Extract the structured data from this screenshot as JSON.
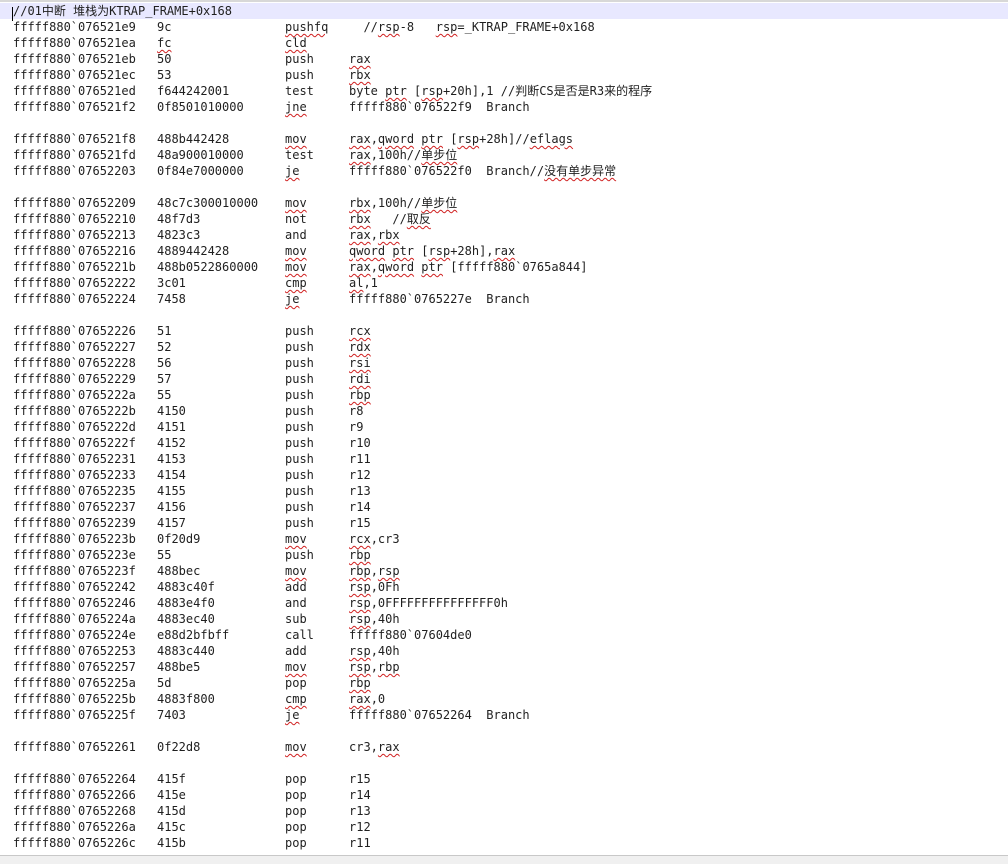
{
  "editor": {
    "colors": {
      "current_line": "#e8e8ff",
      "spell_error": "#d02020"
    },
    "lines": [
      {
        "text": "//01中断 堆栈为KTRAP_FRAME+0x168"
      },
      {
        "addr": "fffff880`076521e9",
        "bytes": "9c",
        "mn": "pushfq",
        "op": "  //rsp-8   rsp=_KTRAP_FRAME+0x168",
        "sq": [
          "pushfq",
          "rsp",
          "rsp"
        ]
      },
      {
        "addr": "fffff880`076521ea",
        "bytes": "fc",
        "mn": "cld",
        "op": "",
        "sq": [
          "fc",
          "cld"
        ]
      },
      {
        "addr": "fffff880`076521eb",
        "bytes": "50",
        "mn": "push",
        "op": "rax",
        "sq": [
          "rax"
        ]
      },
      {
        "addr": "fffff880`076521ec",
        "bytes": "53",
        "mn": "push",
        "op": "rbx",
        "sq": [
          "rbx"
        ]
      },
      {
        "addr": "fffff880`076521ed",
        "bytes": "f644242001",
        "mn": "test",
        "op": "byte ptr [rsp+20h],1 //判断CS是否是R3来的程序",
        "sq": [
          "ptr",
          "rsp"
        ]
      },
      {
        "addr": "fffff880`076521f2",
        "bytes": "0f8501010000",
        "mn": "jne",
        "op": "fffff880`076522f9  Branch",
        "sq": [
          "jne"
        ]
      },
      {
        "blank": true
      },
      {
        "addr": "fffff880`076521f8",
        "bytes": "488b442428",
        "mn": "mov",
        "op": "rax,qword ptr [rsp+28h]//eflags",
        "sq": [
          "mov",
          "rax",
          "qword",
          "ptr",
          "rsp",
          "eflags"
        ]
      },
      {
        "addr": "fffff880`076521fd",
        "bytes": "48a900010000",
        "mn": "test",
        "op": "rax,100h//单步位",
        "sq": [
          "rax",
          "单步位"
        ]
      },
      {
        "addr": "fffff880`07652203",
        "bytes": "0f84e7000000",
        "mn": "je",
        "op": "fffff880`076522f0  Branch//没有单步异常",
        "sq": [
          "je",
          "没有单步异常"
        ]
      },
      {
        "blank": true
      },
      {
        "addr": "fffff880`07652209",
        "bytes": "48c7c300010000",
        "mn": "mov",
        "op": "rbx,100h//单步位",
        "sq": [
          "mov",
          "rbx",
          "单步位"
        ]
      },
      {
        "addr": "fffff880`07652210",
        "bytes": "48f7d3",
        "mn": "not",
        "op": "rbx   //取反",
        "sq": [
          "rbx",
          "取反"
        ]
      },
      {
        "addr": "fffff880`07652213",
        "bytes": "4823c3",
        "mn": "and",
        "op": "rax,rbx",
        "sq": [
          "rax",
          "rbx"
        ]
      },
      {
        "addr": "fffff880`07652216",
        "bytes": "4889442428",
        "mn": "mov",
        "op": "qword ptr [rsp+28h],rax",
        "sq": [
          "mov",
          "qword",
          "ptr",
          "rsp",
          "rax"
        ]
      },
      {
        "addr": "fffff880`0765221b",
        "bytes": "488b0522860000",
        "mn": "mov",
        "op": "rax,qword ptr [fffff880`0765a844]",
        "sq": [
          "mov",
          "rax",
          "qword",
          "ptr"
        ]
      },
      {
        "addr": "fffff880`07652222",
        "bytes": "3c01",
        "mn": "cmp",
        "op": "al,1",
        "sq": [
          "cmp",
          "al"
        ]
      },
      {
        "addr": "fffff880`07652224",
        "bytes": "7458",
        "mn": "je",
        "op": "fffff880`0765227e  Branch",
        "sq": [
          "je"
        ]
      },
      {
        "blank": true
      },
      {
        "addr": "fffff880`07652226",
        "bytes": "51",
        "mn": "push",
        "op": "rcx",
        "sq": [
          "rcx"
        ]
      },
      {
        "addr": "fffff880`07652227",
        "bytes": "52",
        "mn": "push",
        "op": "rdx",
        "sq": [
          "rdx"
        ]
      },
      {
        "addr": "fffff880`07652228",
        "bytes": "56",
        "mn": "push",
        "op": "rsi",
        "sq": [
          "rsi"
        ]
      },
      {
        "addr": "fffff880`07652229",
        "bytes": "57",
        "mn": "push",
        "op": "rdi",
        "sq": [
          "rdi"
        ]
      },
      {
        "addr": "fffff880`0765222a",
        "bytes": "55",
        "mn": "push",
        "op": "rbp",
        "sq": [
          "rbp"
        ]
      },
      {
        "addr": "fffff880`0765222b",
        "bytes": "4150",
        "mn": "push",
        "op": "r8",
        "sq": []
      },
      {
        "addr": "fffff880`0765222d",
        "bytes": "4151",
        "mn": "push",
        "op": "r9",
        "sq": []
      },
      {
        "addr": "fffff880`0765222f",
        "bytes": "4152",
        "mn": "push",
        "op": "r10",
        "sq": []
      },
      {
        "addr": "fffff880`07652231",
        "bytes": "4153",
        "mn": "push",
        "op": "r11",
        "sq": []
      },
      {
        "addr": "fffff880`07652233",
        "bytes": "4154",
        "mn": "push",
        "op": "r12",
        "sq": []
      },
      {
        "addr": "fffff880`07652235",
        "bytes": "4155",
        "mn": "push",
        "op": "r13",
        "sq": []
      },
      {
        "addr": "fffff880`07652237",
        "bytes": "4156",
        "mn": "push",
        "op": "r14",
        "sq": []
      },
      {
        "addr": "fffff880`07652239",
        "bytes": "4157",
        "mn": "push",
        "op": "r15",
        "sq": []
      },
      {
        "addr": "fffff880`0765223b",
        "bytes": "0f20d9",
        "mn": "mov",
        "op": "rcx,cr3",
        "sq": [
          "mov",
          "rcx"
        ]
      },
      {
        "addr": "fffff880`0765223e",
        "bytes": "55",
        "mn": "push",
        "op": "rbp",
        "sq": [
          "rbp"
        ]
      },
      {
        "addr": "fffff880`0765223f",
        "bytes": "488bec",
        "mn": "mov",
        "op": "rbp,rsp",
        "sq": [
          "mov",
          "rbp",
          "rsp"
        ]
      },
      {
        "addr": "fffff880`07652242",
        "bytes": "4883c40f",
        "mn": "add",
        "op": "rsp,0Fh",
        "sq": [
          "rsp"
        ]
      },
      {
        "addr": "fffff880`07652246",
        "bytes": "4883e4f0",
        "mn": "and",
        "op": "rsp,0FFFFFFFFFFFFFFF0h",
        "sq": [
          "rsp"
        ]
      },
      {
        "addr": "fffff880`0765224a",
        "bytes": "4883ec40",
        "mn": "sub",
        "op": "rsp,40h",
        "sq": [
          "rsp"
        ]
      },
      {
        "addr": "fffff880`0765224e",
        "bytes": "e88d2bfbff",
        "mn": "call",
        "op": "fffff880`07604de0",
        "sq": []
      },
      {
        "addr": "fffff880`07652253",
        "bytes": "4883c440",
        "mn": "add",
        "op": "rsp,40h",
        "sq": [
          "rsp"
        ]
      },
      {
        "addr": "fffff880`07652257",
        "bytes": "488be5",
        "mn": "mov",
        "op": "rsp,rbp",
        "sq": [
          "mov",
          "rsp",
          "rbp"
        ]
      },
      {
        "addr": "fffff880`0765225a",
        "bytes": "5d",
        "mn": "pop",
        "op": "rbp",
        "sq": [
          "rbp"
        ]
      },
      {
        "addr": "fffff880`0765225b",
        "bytes": "4883f800",
        "mn": "cmp",
        "op": "rax,0",
        "sq": [
          "cmp",
          "rax"
        ]
      },
      {
        "addr": "fffff880`0765225f",
        "bytes": "7403",
        "mn": "je",
        "op": "fffff880`07652264  Branch",
        "sq": [
          "je"
        ]
      },
      {
        "blank": true
      },
      {
        "addr": "fffff880`07652261",
        "bytes": "0f22d8",
        "mn": "mov",
        "op": "cr3,rax",
        "sq": [
          "mov",
          "rax"
        ]
      },
      {
        "blank": true
      },
      {
        "addr": "fffff880`07652264",
        "bytes": "415f",
        "mn": "pop",
        "op": "r15",
        "sq": []
      },
      {
        "addr": "fffff880`07652266",
        "bytes": "415e",
        "mn": "pop",
        "op": "r14",
        "sq": []
      },
      {
        "addr": "fffff880`07652268",
        "bytes": "415d",
        "mn": "pop",
        "op": "r13",
        "sq": []
      },
      {
        "addr": "fffff880`0765226a",
        "bytes": "415c",
        "mn": "pop",
        "op": "r12",
        "sq": []
      },
      {
        "addr": "fffff880`0765226c",
        "bytes": "415b",
        "mn": "pop",
        "op": "r11",
        "sq": []
      }
    ]
  }
}
